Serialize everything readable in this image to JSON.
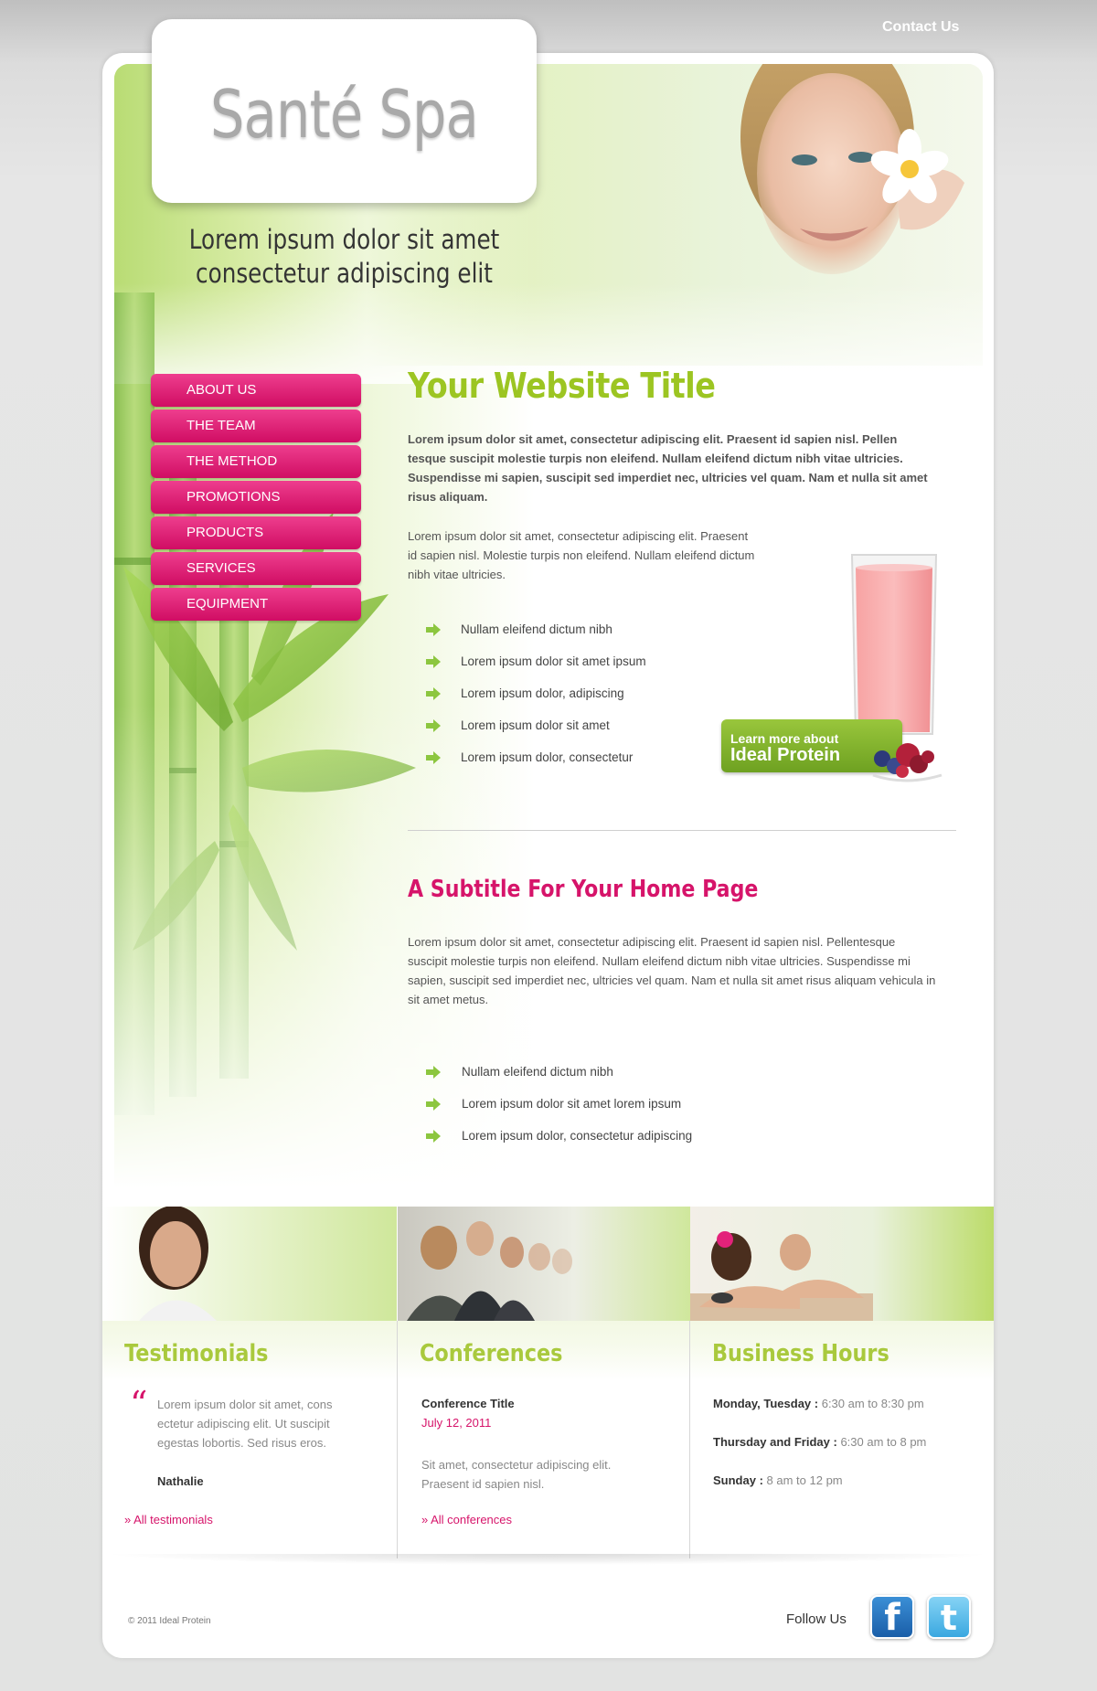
{
  "header": {
    "contact_link": "Contact Us",
    "logo": "Santé Spa",
    "tagline_line1": "Lorem ipsum dolor sit amet",
    "tagline_line2": "consectetur adipiscing elit"
  },
  "nav": {
    "items": [
      {
        "label": "ABOUT US"
      },
      {
        "label": "THE TEAM"
      },
      {
        "label": "THE METHOD"
      },
      {
        "label": "PROMOTIONS"
      },
      {
        "label": "PRODUCTS"
      },
      {
        "label": "SERVICES"
      },
      {
        "label": "EQUIPMENT"
      }
    ]
  },
  "main": {
    "title": "Your Website Title",
    "lead": "Lorem ipsum dolor sit amet, consectetur adipiscing elit. Praesent id sapien nisl. Pellen tesque suscipit molestie turpis non eleifend. Nullam eleifend dictum nibh vitae ultricies. Suspendisse mi sapien, suscipit sed imperdiet nec, ultricies vel quam. Nam et nulla sit amet risus aliquam.",
    "paragraph": "Lorem ipsum dolor sit amet, consectetur adipiscing elit. Praesent id sapien nisl. Molestie turpis non eleifend. Nullam eleifend dictum nibh vitae ultricies.",
    "bullets": [
      "Nullam eleifend dictum nibh",
      "Lorem ipsum dolor sit amet ipsum",
      "Lorem ipsum dolor, adipiscing",
      "Lorem ipsum dolor sit amet",
      "Lorem ipsum dolor, consectetur"
    ],
    "promo_line1": "Learn more about",
    "promo_line2": "Ideal Protein",
    "subtitle": "A Subtitle For Your Home Page",
    "paragraph2": "Lorem ipsum dolor sit amet, consectetur adipiscing elit. Praesent id sapien nisl. Pellentesque suscipit molestie turpis non eleifend. Nullam eleifend dictum nibh vitae ultricies. Suspendisse mi sapien, suscipit sed imperdiet nec, ultricies vel quam. Nam et nulla sit amet risus aliquam vehicula in sit amet metus.",
    "bullets2": [
      "Nullam eleifend dictum nibh",
      "Lorem ipsum dolor sit amet lorem ipsum",
      "Lorem ipsum dolor, consectetur adipiscing"
    ]
  },
  "testimonials": {
    "title": "Testimonials",
    "quote_mark": "“",
    "text": "Lorem ipsum dolor sit amet, cons ectetur adipiscing elit. Ut suscipit egestas lobortis. Sed risus eros.",
    "author": "Nathalie",
    "link": "» All testimonials"
  },
  "conferences": {
    "title": "Conferences",
    "item_title": "Conference Title",
    "item_date": "July 12, 2011",
    "item_desc": "Sit amet, consectetur adipiscing elit. Praesent id sapien nisl.",
    "link": "» All conferences"
  },
  "hours": {
    "title": "Business Hours",
    "rows": [
      {
        "day": "Monday, Tuesday :",
        "time": "6:30 am to 8:30 pm"
      },
      {
        "day": "Thursday and Friday :",
        "time": "6:30 am to 8 pm"
      },
      {
        "day": "Sunday :",
        "time": "8 am to 12 pm"
      }
    ]
  },
  "footer": {
    "copyright": "© 2011 Ideal Protein",
    "follow": "Follow Us",
    "facebook_glyph": "f",
    "twitter_glyph": "t"
  },
  "colors": {
    "accent_green": "#9cc522",
    "accent_pink": "#d6146a",
    "nav_pink": "#e41f77"
  },
  "icons": [
    "arrow-right-icon",
    "facebook-icon",
    "twitter-icon",
    "quote-icon"
  ]
}
